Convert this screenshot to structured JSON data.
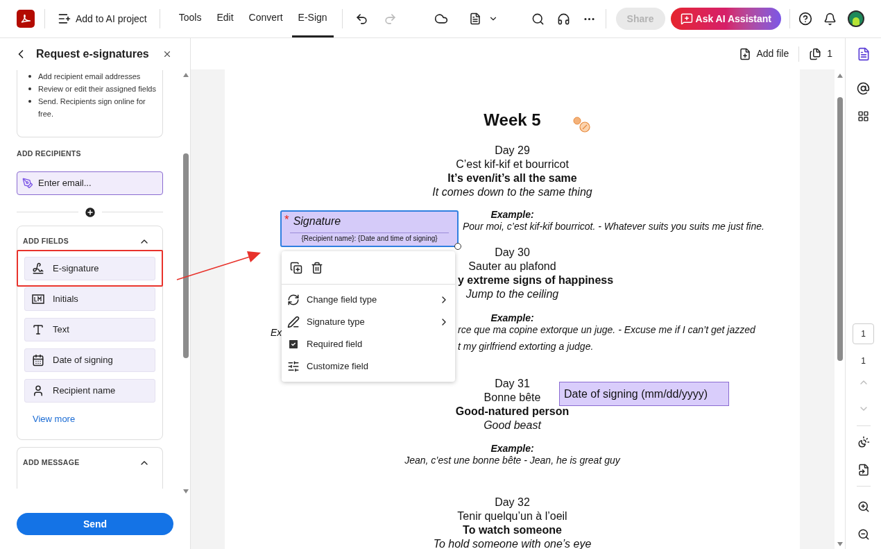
{
  "toolbar": {
    "add_to_ai": "Add to AI project",
    "menu": [
      {
        "label": "Tools",
        "selected": false
      },
      {
        "label": "Edit",
        "selected": false
      },
      {
        "label": "Convert",
        "selected": false
      },
      {
        "label": "E-Sign",
        "selected": true
      }
    ],
    "share": "Share",
    "ask_ai": "Ask AI Assistant"
  },
  "panel": {
    "title": "Request e-signatures",
    "steps": [
      "Add recipient email addresses",
      "Review or edit their assigned fields",
      "Send. Recipients sign online for free."
    ],
    "recipients_heading": "ADD RECIPIENTS",
    "email_placeholder": "Enter email...",
    "fields_heading": "ADD FIELDS",
    "fields": [
      {
        "label": "E-signature",
        "kind": "signature",
        "highlighted": true
      },
      {
        "label": "Initials",
        "kind": "initials",
        "highlighted": false
      },
      {
        "label": "Text",
        "kind": "text",
        "highlighted": false
      },
      {
        "label": "Date of signing",
        "kind": "date",
        "highlighted": false
      },
      {
        "label": "Recipient name",
        "kind": "name",
        "highlighted": false
      }
    ],
    "view_more": "View more",
    "message_heading": "ADD MESSAGE",
    "send": "Send"
  },
  "doc_bar": {
    "add_file": "Add file",
    "page_count": "1"
  },
  "document": {
    "title": "Week 5",
    "blocks": [
      {
        "lines": [
          {
            "kind": "plain",
            "text": "Day 29"
          },
          {
            "kind": "plain",
            "text": "C’est kif-kif et bourricot"
          },
          {
            "kind": "bold",
            "text": "It’s even/it’s all the same"
          },
          {
            "kind": "italic",
            "text": "It comes down to the same thing"
          }
        ]
      },
      {
        "lines": [
          {
            "kind": "example_label",
            "text": "Example:"
          },
          {
            "kind": "example_beside_field",
            "text": "Pour moi, c’est kif-kif bourricot. - Whatever suits you suits me just fine."
          }
        ]
      },
      {
        "lines": [
          {
            "kind": "plain",
            "text": "Day 30"
          },
          {
            "kind": "plain",
            "text": "Sauter au plafond"
          },
          {
            "kind": "split_bold",
            "right": "y extreme signs of happiness"
          },
          {
            "kind": "italic",
            "text": "Jump to the ceiling"
          }
        ]
      },
      {
        "lines": [
          {
            "kind": "example_label",
            "text": "Example:"
          },
          {
            "kind": "split_example",
            "left": "Ex",
            "right": "rce que ma copine extorque un juge. - Excuse me if I can’t get jazzed"
          },
          {
            "kind": "split_example",
            "right": "t my girlfriend extorting a judge."
          }
        ]
      },
      {
        "lines": [
          {
            "kind": "plain",
            "text": "Day 31"
          },
          {
            "kind": "plain",
            "text": "Bonne bête"
          },
          {
            "kind": "bold",
            "text": "Good-natured person"
          },
          {
            "kind": "italic",
            "text": "Good beast"
          }
        ]
      },
      {
        "lines": [
          {
            "kind": "example_label",
            "text": "Example:"
          },
          {
            "kind": "example",
            "text": "Jean, c’est une bonne bête - Jean, he is great guy"
          }
        ]
      },
      {
        "lines": [
          {
            "kind": "plain",
            "text": "Day 32"
          },
          {
            "kind": "plain",
            "text": "Tenir quelqu’un à l’oeil"
          },
          {
            "kind": "bold",
            "text": "To watch someone"
          },
          {
            "kind": "italic",
            "text": "To hold someone with one’s eye"
          }
        ]
      }
    ]
  },
  "signature_field": {
    "label": "Signature",
    "required": true,
    "required_mark": "*",
    "caption": "{Recipient name}: {Date and time of signing}"
  },
  "field_menu": {
    "items": [
      {
        "label": "Change field type",
        "kind": "submenu"
      },
      {
        "label": "Signature type",
        "kind": "submenu"
      },
      {
        "label": "Required field",
        "kind": "check",
        "checked": true
      },
      {
        "label": "Customize field",
        "kind": "action"
      }
    ]
  },
  "date_field": {
    "label": "Date of signing (mm/dd/yyyy)"
  },
  "page_nav": {
    "current": "1",
    "total": "1"
  }
}
